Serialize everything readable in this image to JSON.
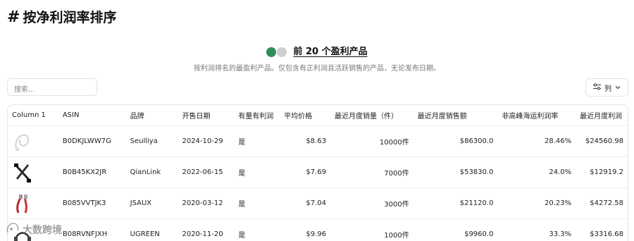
{
  "page": {
    "hash": "#",
    "title": "按净利润率排序",
    "heading": "前 20 个盈利产品",
    "description": "按利润排名的最盈利产品。仅包含有正利润且活跃销售的产品，无论发布日期。"
  },
  "search": {
    "placeholder": "搜索..."
  },
  "toolbar": {
    "columns_label": "列"
  },
  "table": {
    "headers": [
      "Column 1",
      "ASIN",
      "品牌",
      "开售日期",
      "有量有利润",
      "平均价格",
      "最近月度销量（件）",
      "最近月度销售额",
      "非高峰海运利润率",
      "最近月度利润"
    ],
    "rows": [
      {
        "thumb": "cable-white",
        "asin": "B0DKJLWW7G",
        "brand": "Seulliya",
        "date": "2024-10-29",
        "profit_flag": "是",
        "price": "$8.63",
        "units": "10000件",
        "revenue": "$86300.0",
        "margin": "28.46%",
        "profit": "$24560.98"
      },
      {
        "thumb": "cable-black",
        "asin": "B0B45KX2JR",
        "brand": "QianLink",
        "date": "2022-06-15",
        "profit_flag": "是",
        "price": "$7.69",
        "units": "7000件",
        "revenue": "$53830.0",
        "margin": "24.0%",
        "profit": "$12919.2"
      },
      {
        "thumb": "cable-red",
        "asin": "B085VVTJK3",
        "brand": "JSAUX",
        "date": "2020-03-12",
        "profit_flag": "是",
        "price": "$7.04",
        "units": "3000件",
        "revenue": "$21120.0",
        "margin": "20.23%",
        "profit": "$4272.58"
      },
      {
        "thumb": "cable-dark",
        "asin": "B08RVNFJXH",
        "brand": "UGREEN",
        "date": "2020-11-20",
        "profit_flag": "是",
        "price": "$9.96",
        "units": "1000件",
        "revenue": "$9960.0",
        "margin": "33.3%",
        "profit": "$3316.68"
      }
    ]
  },
  "watermark": {
    "text": "大数跨境"
  },
  "icons": {
    "heading": "smiley-icons",
    "filter": "sliders-icon",
    "chevron": "chevron-down-icon"
  }
}
